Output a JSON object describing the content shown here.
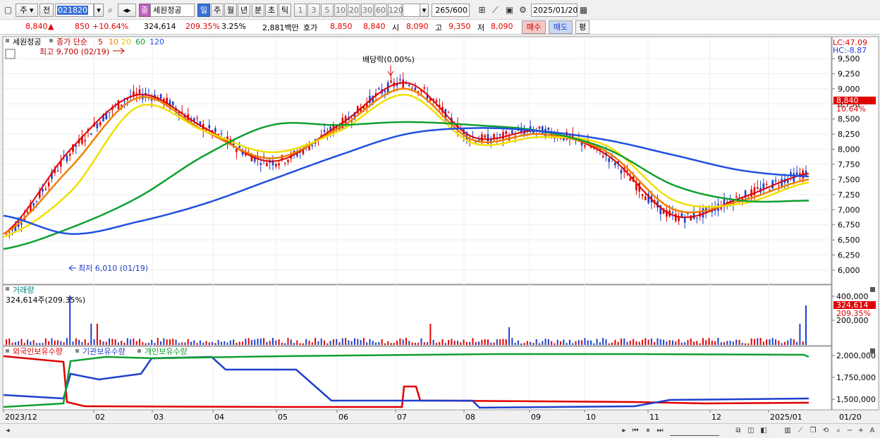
{
  "toolbar": {
    "market": "주",
    "prev": "전",
    "code": "021820",
    "name_badge": "종",
    "stock_name": "세원정공",
    "periods": [
      "일",
      "주",
      "월",
      "년",
      "분",
      "초",
      "틱"
    ],
    "active_period": "일",
    "intervals": [
      "1",
      "3",
      "5",
      "10",
      "20",
      "30",
      "60",
      "120"
    ],
    "count": "265",
    "count_max": "/600",
    "date": "2025/01/20"
  },
  "quote": {
    "price": "8,840",
    "arrow": "▲",
    "change": "850",
    "change_pct": "+10.64%",
    "volume": "324,614",
    "volume_ratio": "209.35%",
    "turnover": "3.25%",
    "amount": "2,881백만",
    "hoga_label": "호가",
    "ask": "8,850",
    "bid": "8,840",
    "open_label": "시",
    "open": "8,090",
    "high_label": "고",
    "high": "9,350",
    "low_label": "저",
    "low": "8,090",
    "buy": "매수",
    "sell": "매도",
    "eval": "평"
  },
  "price_panel": {
    "title": "세원정공",
    "legend_label": "종가 단순",
    "ma_labels": [
      "5",
      "10",
      "20",
      "60",
      "120"
    ],
    "ma_colors": [
      "#e00000",
      "#f08000",
      "#f0e000",
      "#10a030",
      "#2050e0"
    ],
    "high_note": "최고 9,700 (02/19)",
    "low_note": "최저 6,010 (01/19)",
    "dividend_note": "배당락(0.00%)",
    "lc": "LC:47.09",
    "hc": "HC:-8.87",
    "current_price": "8,840",
    "current_pct": "10.64%",
    "yticks": [
      "9,500",
      "9,250",
      "9,000",
      "8,750",
      "8,500",
      "8,250",
      "8,000",
      "7,750",
      "7,500",
      "7,250",
      "7,000",
      "6,750",
      "6,500",
      "6,250",
      "6,000"
    ]
  },
  "volume_panel": {
    "title": "거래량",
    "value": "324,614주(209.35%)",
    "current": "324,614",
    "current_pct": "209.35%",
    "yticks": [
      "400,000",
      "200,000"
    ]
  },
  "holdings_panel": {
    "legend": [
      "외국인보유수량",
      "기관보유수량",
      "개인보유수량"
    ],
    "colors": [
      "#e00000",
      "#2050e0",
      "#10a030"
    ],
    "yticks": [
      "2,000,000",
      "1,750,000",
      "1,500,000"
    ]
  },
  "xaxis": {
    "labels": [
      "2023/12",
      "02",
      "03",
      "04",
      "05",
      "06",
      "07",
      "08",
      "09",
      "10",
      "11",
      "12",
      "2025/01"
    ],
    "right_label": "01/20"
  },
  "chart_data": {
    "type": "line",
    "title": "세원정공",
    "x": [
      "2023/12",
      "02",
      "03",
      "04",
      "05",
      "06",
      "07",
      "08",
      "09",
      "10",
      "11",
      "12",
      "2025/01"
    ],
    "ylim": [
      6000,
      9500
    ],
    "series": [
      {
        "name": "5",
        "values": [
          6600,
          8000,
          8900,
          8350,
          7800,
          8400,
          9100,
          8200,
          8300,
          7900,
          6900,
          7200,
          7600
        ]
      },
      {
        "name": "10",
        "values": [
          6600,
          7700,
          8850,
          8300,
          7850,
          8350,
          9000,
          8150,
          8250,
          7950,
          7000,
          7150,
          7500
        ]
      },
      {
        "name": "20",
        "values": [
          6550,
          7300,
          8700,
          8300,
          7950,
          8300,
          8900,
          8100,
          8200,
          8050,
          7150,
          7100,
          7450
        ]
      },
      {
        "name": "60",
        "values": [
          6350,
          6700,
          7200,
          7900,
          8400,
          8400,
          8450,
          8400,
          8300,
          8000,
          7400,
          7150,
          7150
        ]
      },
      {
        "name": "120",
        "values": [
          6900,
          6600,
          6800,
          7100,
          7500,
          7900,
          8250,
          8350,
          8300,
          8150,
          7900,
          7650,
          7550
        ]
      }
    ]
  }
}
